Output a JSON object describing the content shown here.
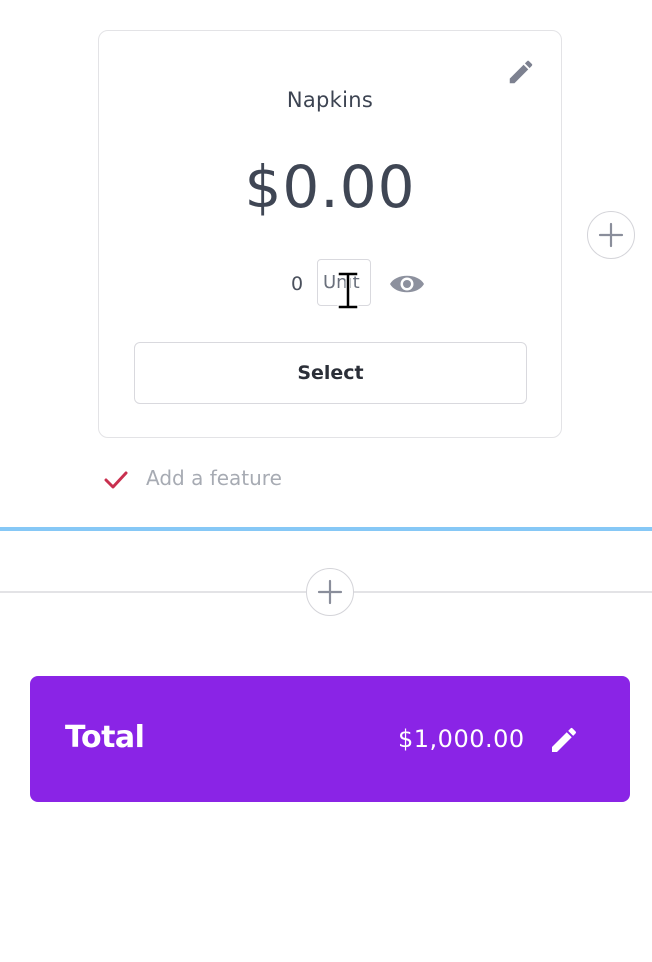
{
  "card": {
    "product_name": "Napkins",
    "price": "$0.00",
    "quantity": "0",
    "unit_placeholder": "Unit",
    "select_label": "Select",
    "edit_icon": "pencil-icon",
    "visibility_icon": "eye-icon"
  },
  "features": {
    "add_feature_placeholder": "Add a feature",
    "check_icon": "checkmark-icon",
    "check_color": "#c9304f"
  },
  "controls": {
    "add_icon": "plus-icon",
    "divider_highlight_color": "#86c8f6"
  },
  "total": {
    "label": "Total",
    "amount": "$1,000.00",
    "background_color": "#8a24e6",
    "edit_icon": "pencil-icon"
  }
}
